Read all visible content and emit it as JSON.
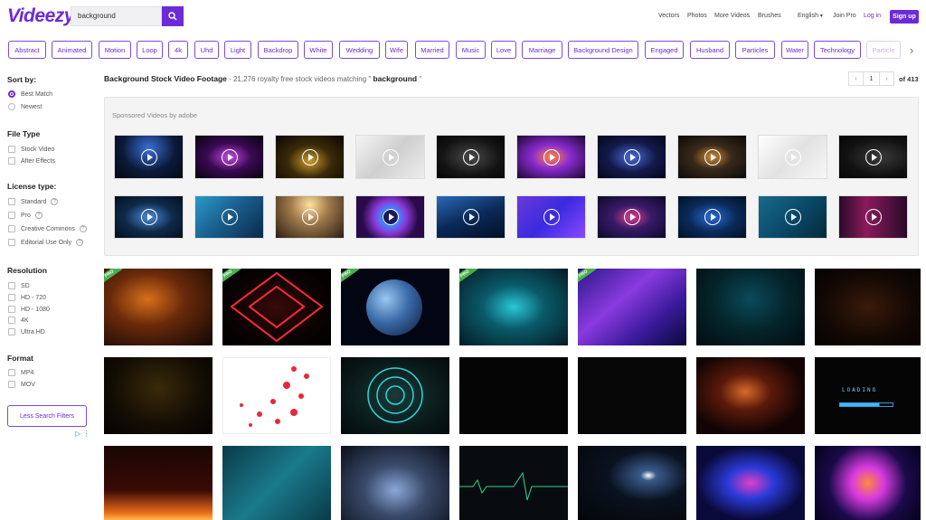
{
  "header": {
    "logo": "Videezy",
    "search_value": "background",
    "nav": [
      "Vectors",
      "Photos",
      "More Videos",
      "Brushes"
    ],
    "language": "English",
    "join_pro": "Join Pro",
    "login": "Log in",
    "signup": "Sign up"
  },
  "tags": [
    "Abstract",
    "Animated",
    "Motion",
    "Loop",
    "4k",
    "Uhd",
    "Light",
    "Backdrop",
    "White",
    "Wedding",
    "Wife",
    "Married",
    "Music",
    "Love",
    "Marriage",
    "Background Design",
    "Engaged",
    "Husband",
    "Particles",
    "Water",
    "Technology",
    "Particle"
  ],
  "sidebar": {
    "sort_by": {
      "heading": "Sort by:",
      "options": [
        "Best Match",
        "Newest"
      ],
      "selected": "Best Match"
    },
    "file_type": {
      "heading": "File Type",
      "options": [
        "Stock Video",
        "After Effects"
      ]
    },
    "license": {
      "heading": "License type:",
      "options": [
        "Standard",
        "Pro",
        "Creative Commons",
        "Editorial Use Only"
      ]
    },
    "resolution": {
      "heading": "Resolution",
      "options": [
        "SD",
        "HD - 720",
        "HD - 1080",
        "4K",
        "Ultra HD"
      ]
    },
    "format": {
      "heading": "Format",
      "options": [
        "MP4",
        "MOV"
      ]
    },
    "less_filters": "Less Search Filters",
    "question_mark": "?",
    "ad_choice": "▷ ⋮"
  },
  "main": {
    "title": "Background Stock Video Footage",
    "subtitle_pre": " - 21,276 royalty free stock videos matching \" ",
    "query": "background",
    "subtitle_post": " \"",
    "page": "1",
    "page_prev": "‹",
    "page_next": "›",
    "page_of": "of 413",
    "sponsored_label": "Sponsored Videos by adobe",
    "pro_badge": "PRO"
  },
  "colors": {
    "accent": "#6c2bd9",
    "pro_badge": "#4caf50"
  }
}
